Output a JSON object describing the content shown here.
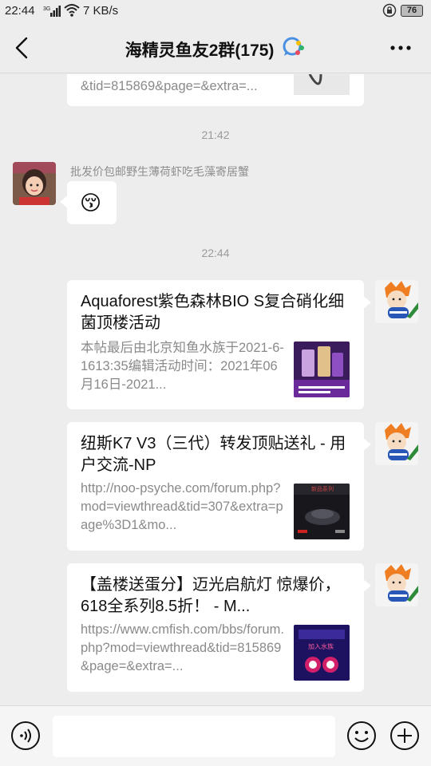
{
  "status": {
    "time": "22:44",
    "network": "3G",
    "speed": "7 KB/s",
    "battery": "76"
  },
  "header": {
    "title": "海精灵鱼友2群(175)"
  },
  "messages": [
    {
      "type": "card",
      "desc_tail": "&tid=815869&page=&extra=..."
    },
    {
      "type": "time",
      "text": "21:42"
    },
    {
      "type": "text",
      "sender": "批发价包邮野生薄荷虾吃毛藻寄居蟹",
      "content": "😚"
    },
    {
      "type": "time",
      "text": "22:44"
    },
    {
      "type": "card",
      "title": "Aquaforest紫色森林BIO S复合硝化细菌顶楼活动",
      "desc": "本帖最后由北京知鱼水族于2021-6-1613:35编辑活动时间：2021年06月16日-2021..."
    },
    {
      "type": "card",
      "title": "纽斯K7 V3（三代）转发顶贴送礼 - 用户交流-NP",
      "desc": "http://noo-psyche.com/forum.php?mod=viewthread&tid=307&extra=page%3D1&mo..."
    },
    {
      "type": "card",
      "title": "【盖楼送蛋分】迈光启航灯 惊爆价，618全系列8.5折！ - M...",
      "desc": "https://www.cmfish.com/bbs/forum.php?mod=viewthread&tid=815869&page=&extra=..."
    }
  ],
  "thumbs": {
    "card3_label": "加入水族",
    "card4_label": "新品系列"
  },
  "input": {
    "placeholder": ""
  },
  "colors": {
    "background": "#ededed",
    "bubble": "#ffffff",
    "gray_text": "#8a8a8a",
    "time_text": "#9a9a9a"
  },
  "icons": [
    "back-icon",
    "more-icon",
    "group-chat-icon",
    "voice-icon",
    "emoji-icon",
    "plus-icon"
  ]
}
